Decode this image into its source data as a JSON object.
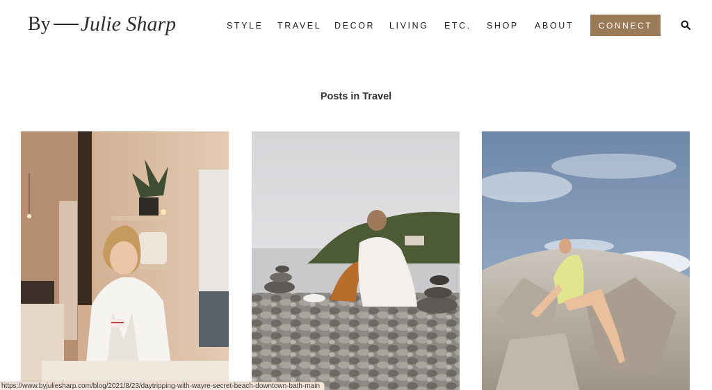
{
  "site": {
    "logo_prefix": "By",
    "logo_name": "Julie Sharp"
  },
  "nav": {
    "items": [
      {
        "label": "STYLE"
      },
      {
        "label": "TRAVEL"
      },
      {
        "label": "DECOR"
      },
      {
        "label": "LIVING"
      },
      {
        "label": "ETC."
      },
      {
        "label": "SHOP"
      },
      {
        "label": "ABOUT"
      }
    ],
    "connect_label": "CONNECT",
    "search_icon": "search-icon"
  },
  "main": {
    "section_title": "Posts in Travel",
    "posts": [
      {
        "image": "woman-in-white-robe-at-spa"
      },
      {
        "image": "woman-sitting-on-beach-stones-with-cairns"
      },
      {
        "image": "woman-sitting-on-granite-rocks-under-cloudy-sky"
      }
    ]
  },
  "status_bar": {
    "url": "https://www.byjuliesharp.com/blog/2021/8/23/daytripping-with-wayre-secret-beach-downtown-bath-main"
  },
  "colors": {
    "accent": "#9b7a57",
    "text": "#1e1e1e",
    "background": "#ffffff"
  }
}
